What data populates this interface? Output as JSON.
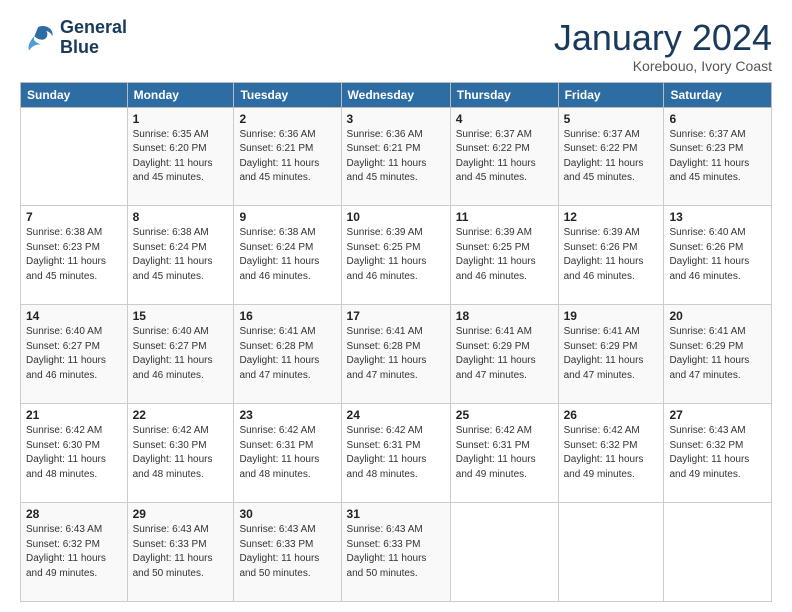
{
  "header": {
    "logo_line1": "General",
    "logo_line2": "Blue",
    "month": "January 2024",
    "location": "Korebouo, Ivory Coast"
  },
  "weekdays": [
    "Sunday",
    "Monday",
    "Tuesday",
    "Wednesday",
    "Thursday",
    "Friday",
    "Saturday"
  ],
  "weeks": [
    [
      {
        "day": "",
        "info": ""
      },
      {
        "day": "1",
        "info": "Sunrise: 6:35 AM\nSunset: 6:20 PM\nDaylight: 11 hours\nand 45 minutes."
      },
      {
        "day": "2",
        "info": "Sunrise: 6:36 AM\nSunset: 6:21 PM\nDaylight: 11 hours\nand 45 minutes."
      },
      {
        "day": "3",
        "info": "Sunrise: 6:36 AM\nSunset: 6:21 PM\nDaylight: 11 hours\nand 45 minutes."
      },
      {
        "day": "4",
        "info": "Sunrise: 6:37 AM\nSunset: 6:22 PM\nDaylight: 11 hours\nand 45 minutes."
      },
      {
        "day": "5",
        "info": "Sunrise: 6:37 AM\nSunset: 6:22 PM\nDaylight: 11 hours\nand 45 minutes."
      },
      {
        "day": "6",
        "info": "Sunrise: 6:37 AM\nSunset: 6:23 PM\nDaylight: 11 hours\nand 45 minutes."
      }
    ],
    [
      {
        "day": "7",
        "info": "Sunrise: 6:38 AM\nSunset: 6:23 PM\nDaylight: 11 hours\nand 45 minutes."
      },
      {
        "day": "8",
        "info": "Sunrise: 6:38 AM\nSunset: 6:24 PM\nDaylight: 11 hours\nand 45 minutes."
      },
      {
        "day": "9",
        "info": "Sunrise: 6:38 AM\nSunset: 6:24 PM\nDaylight: 11 hours\nand 46 minutes."
      },
      {
        "day": "10",
        "info": "Sunrise: 6:39 AM\nSunset: 6:25 PM\nDaylight: 11 hours\nand 46 minutes."
      },
      {
        "day": "11",
        "info": "Sunrise: 6:39 AM\nSunset: 6:25 PM\nDaylight: 11 hours\nand 46 minutes."
      },
      {
        "day": "12",
        "info": "Sunrise: 6:39 AM\nSunset: 6:26 PM\nDaylight: 11 hours\nand 46 minutes."
      },
      {
        "day": "13",
        "info": "Sunrise: 6:40 AM\nSunset: 6:26 PM\nDaylight: 11 hours\nand 46 minutes."
      }
    ],
    [
      {
        "day": "14",
        "info": "Sunrise: 6:40 AM\nSunset: 6:27 PM\nDaylight: 11 hours\nand 46 minutes."
      },
      {
        "day": "15",
        "info": "Sunrise: 6:40 AM\nSunset: 6:27 PM\nDaylight: 11 hours\nand 46 minutes."
      },
      {
        "day": "16",
        "info": "Sunrise: 6:41 AM\nSunset: 6:28 PM\nDaylight: 11 hours\nand 47 minutes."
      },
      {
        "day": "17",
        "info": "Sunrise: 6:41 AM\nSunset: 6:28 PM\nDaylight: 11 hours\nand 47 minutes."
      },
      {
        "day": "18",
        "info": "Sunrise: 6:41 AM\nSunset: 6:29 PM\nDaylight: 11 hours\nand 47 minutes."
      },
      {
        "day": "19",
        "info": "Sunrise: 6:41 AM\nSunset: 6:29 PM\nDaylight: 11 hours\nand 47 minutes."
      },
      {
        "day": "20",
        "info": "Sunrise: 6:41 AM\nSunset: 6:29 PM\nDaylight: 11 hours\nand 47 minutes."
      }
    ],
    [
      {
        "day": "21",
        "info": "Sunrise: 6:42 AM\nSunset: 6:30 PM\nDaylight: 11 hours\nand 48 minutes."
      },
      {
        "day": "22",
        "info": "Sunrise: 6:42 AM\nSunset: 6:30 PM\nDaylight: 11 hours\nand 48 minutes."
      },
      {
        "day": "23",
        "info": "Sunrise: 6:42 AM\nSunset: 6:31 PM\nDaylight: 11 hours\nand 48 minutes."
      },
      {
        "day": "24",
        "info": "Sunrise: 6:42 AM\nSunset: 6:31 PM\nDaylight: 11 hours\nand 48 minutes."
      },
      {
        "day": "25",
        "info": "Sunrise: 6:42 AM\nSunset: 6:31 PM\nDaylight: 11 hours\nand 49 minutes."
      },
      {
        "day": "26",
        "info": "Sunrise: 6:42 AM\nSunset: 6:32 PM\nDaylight: 11 hours\nand 49 minutes."
      },
      {
        "day": "27",
        "info": "Sunrise: 6:43 AM\nSunset: 6:32 PM\nDaylight: 11 hours\nand 49 minutes."
      }
    ],
    [
      {
        "day": "28",
        "info": "Sunrise: 6:43 AM\nSunset: 6:32 PM\nDaylight: 11 hours\nand 49 minutes."
      },
      {
        "day": "29",
        "info": "Sunrise: 6:43 AM\nSunset: 6:33 PM\nDaylight: 11 hours\nand 50 minutes."
      },
      {
        "day": "30",
        "info": "Sunrise: 6:43 AM\nSunset: 6:33 PM\nDaylight: 11 hours\nand 50 minutes."
      },
      {
        "day": "31",
        "info": "Sunrise: 6:43 AM\nSunset: 6:33 PM\nDaylight: 11 hours\nand 50 minutes."
      },
      {
        "day": "",
        "info": ""
      },
      {
        "day": "",
        "info": ""
      },
      {
        "day": "",
        "info": ""
      }
    ]
  ]
}
